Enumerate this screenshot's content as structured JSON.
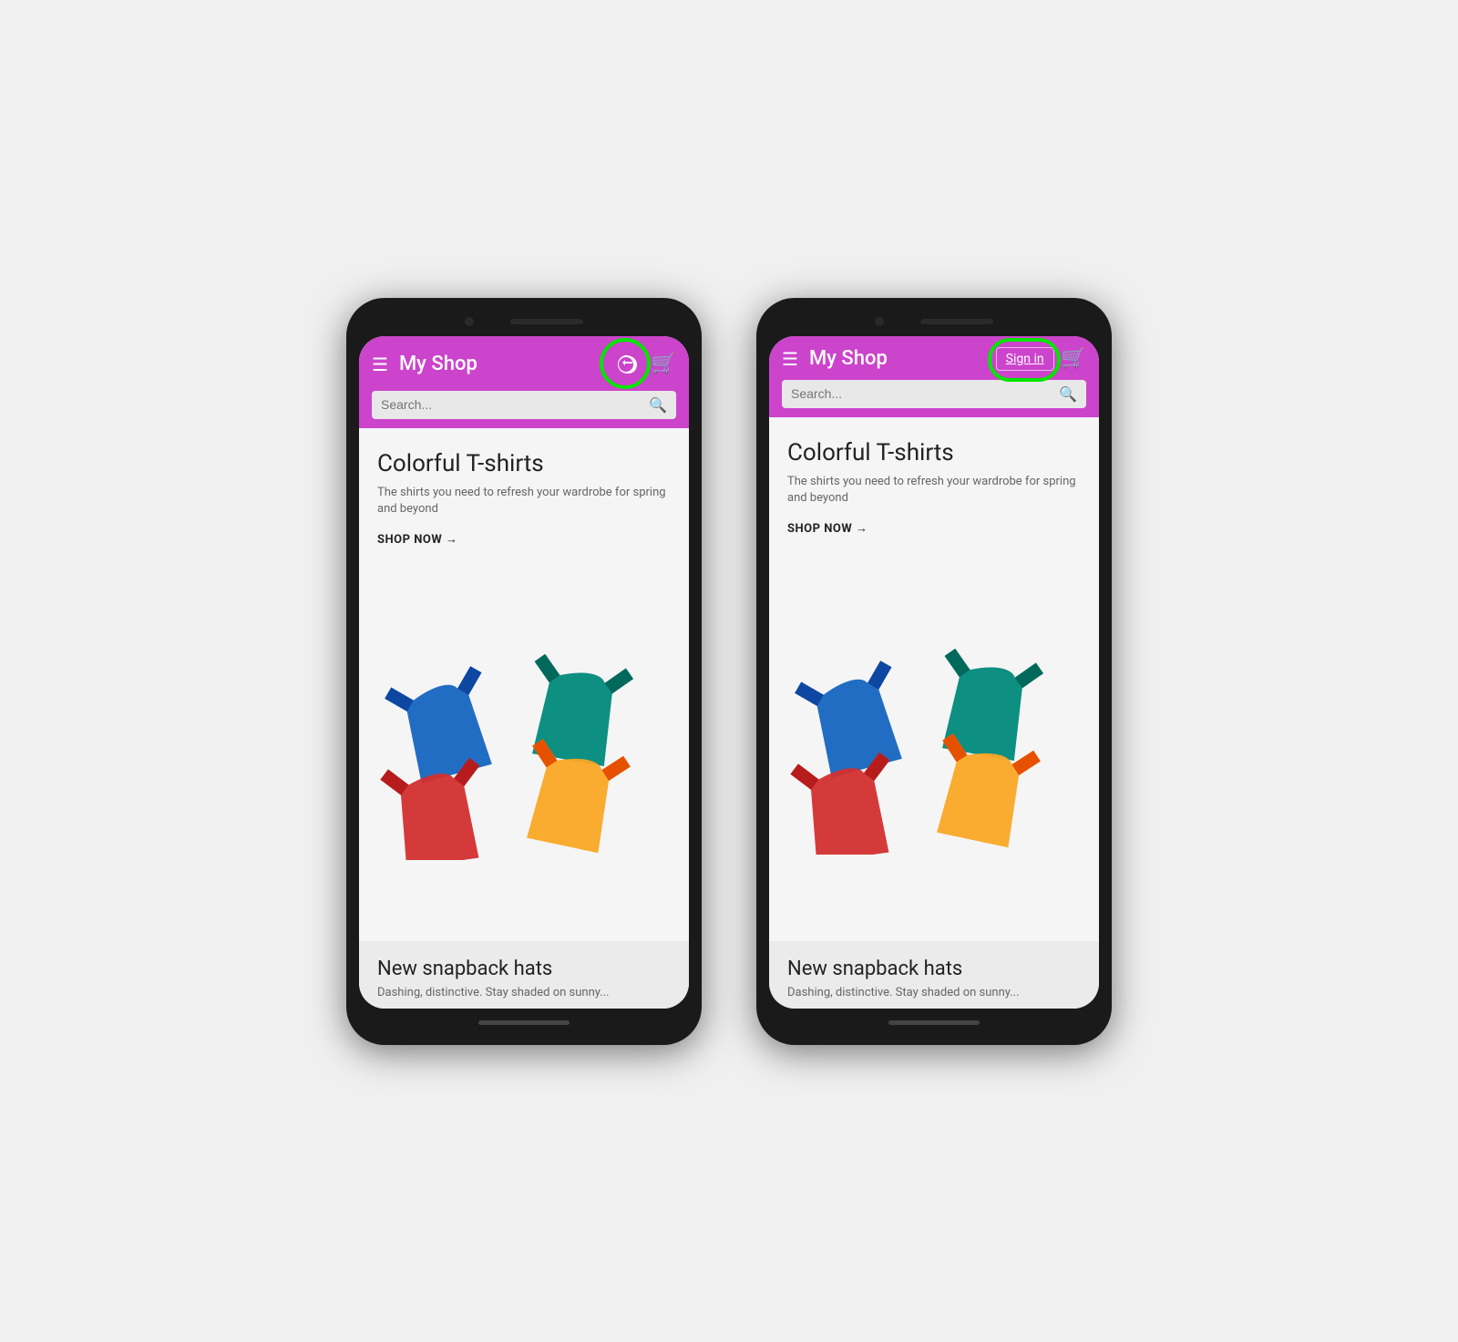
{
  "page": {
    "background_color": "#f0f0f0"
  },
  "phones": [
    {
      "id": "phone-1",
      "header": {
        "title": "My Shop",
        "hamburger_label": "☰",
        "signin_mode": "icon",
        "signin_icon": "⊡",
        "cart_icon": "🛒",
        "search_placeholder": "Search...",
        "search_icon": "🔍"
      },
      "hero": {
        "title": "Colorful T-shirts",
        "subtitle": "The shirts you need to refresh your wardrobe for spring and beyond",
        "cta": "SHOP NOW →"
      },
      "next_section": {
        "title": "New snapback hats",
        "subtitle": "Dashing, distinctive. Stay shaded on sunny..."
      },
      "annotation": {
        "type": "icon",
        "label": "login-icon-annotated"
      }
    },
    {
      "id": "phone-2",
      "header": {
        "title": "My Shop",
        "hamburger_label": "☰",
        "signin_mode": "text",
        "signin_text": "Sign in",
        "cart_icon": "🛒",
        "search_placeholder": "Search...",
        "search_icon": "🔍"
      },
      "hero": {
        "title": "Colorful T-shirts",
        "subtitle": "The shirts you need to refresh your wardrobe for spring and beyond",
        "cta": "SHOP NOW →"
      },
      "next_section": {
        "title": "New snapback hats",
        "subtitle": "Dashing, distinctive. Stay shaded on sunny..."
      },
      "annotation": {
        "type": "text",
        "label": "signin-text-annotated"
      }
    }
  ]
}
